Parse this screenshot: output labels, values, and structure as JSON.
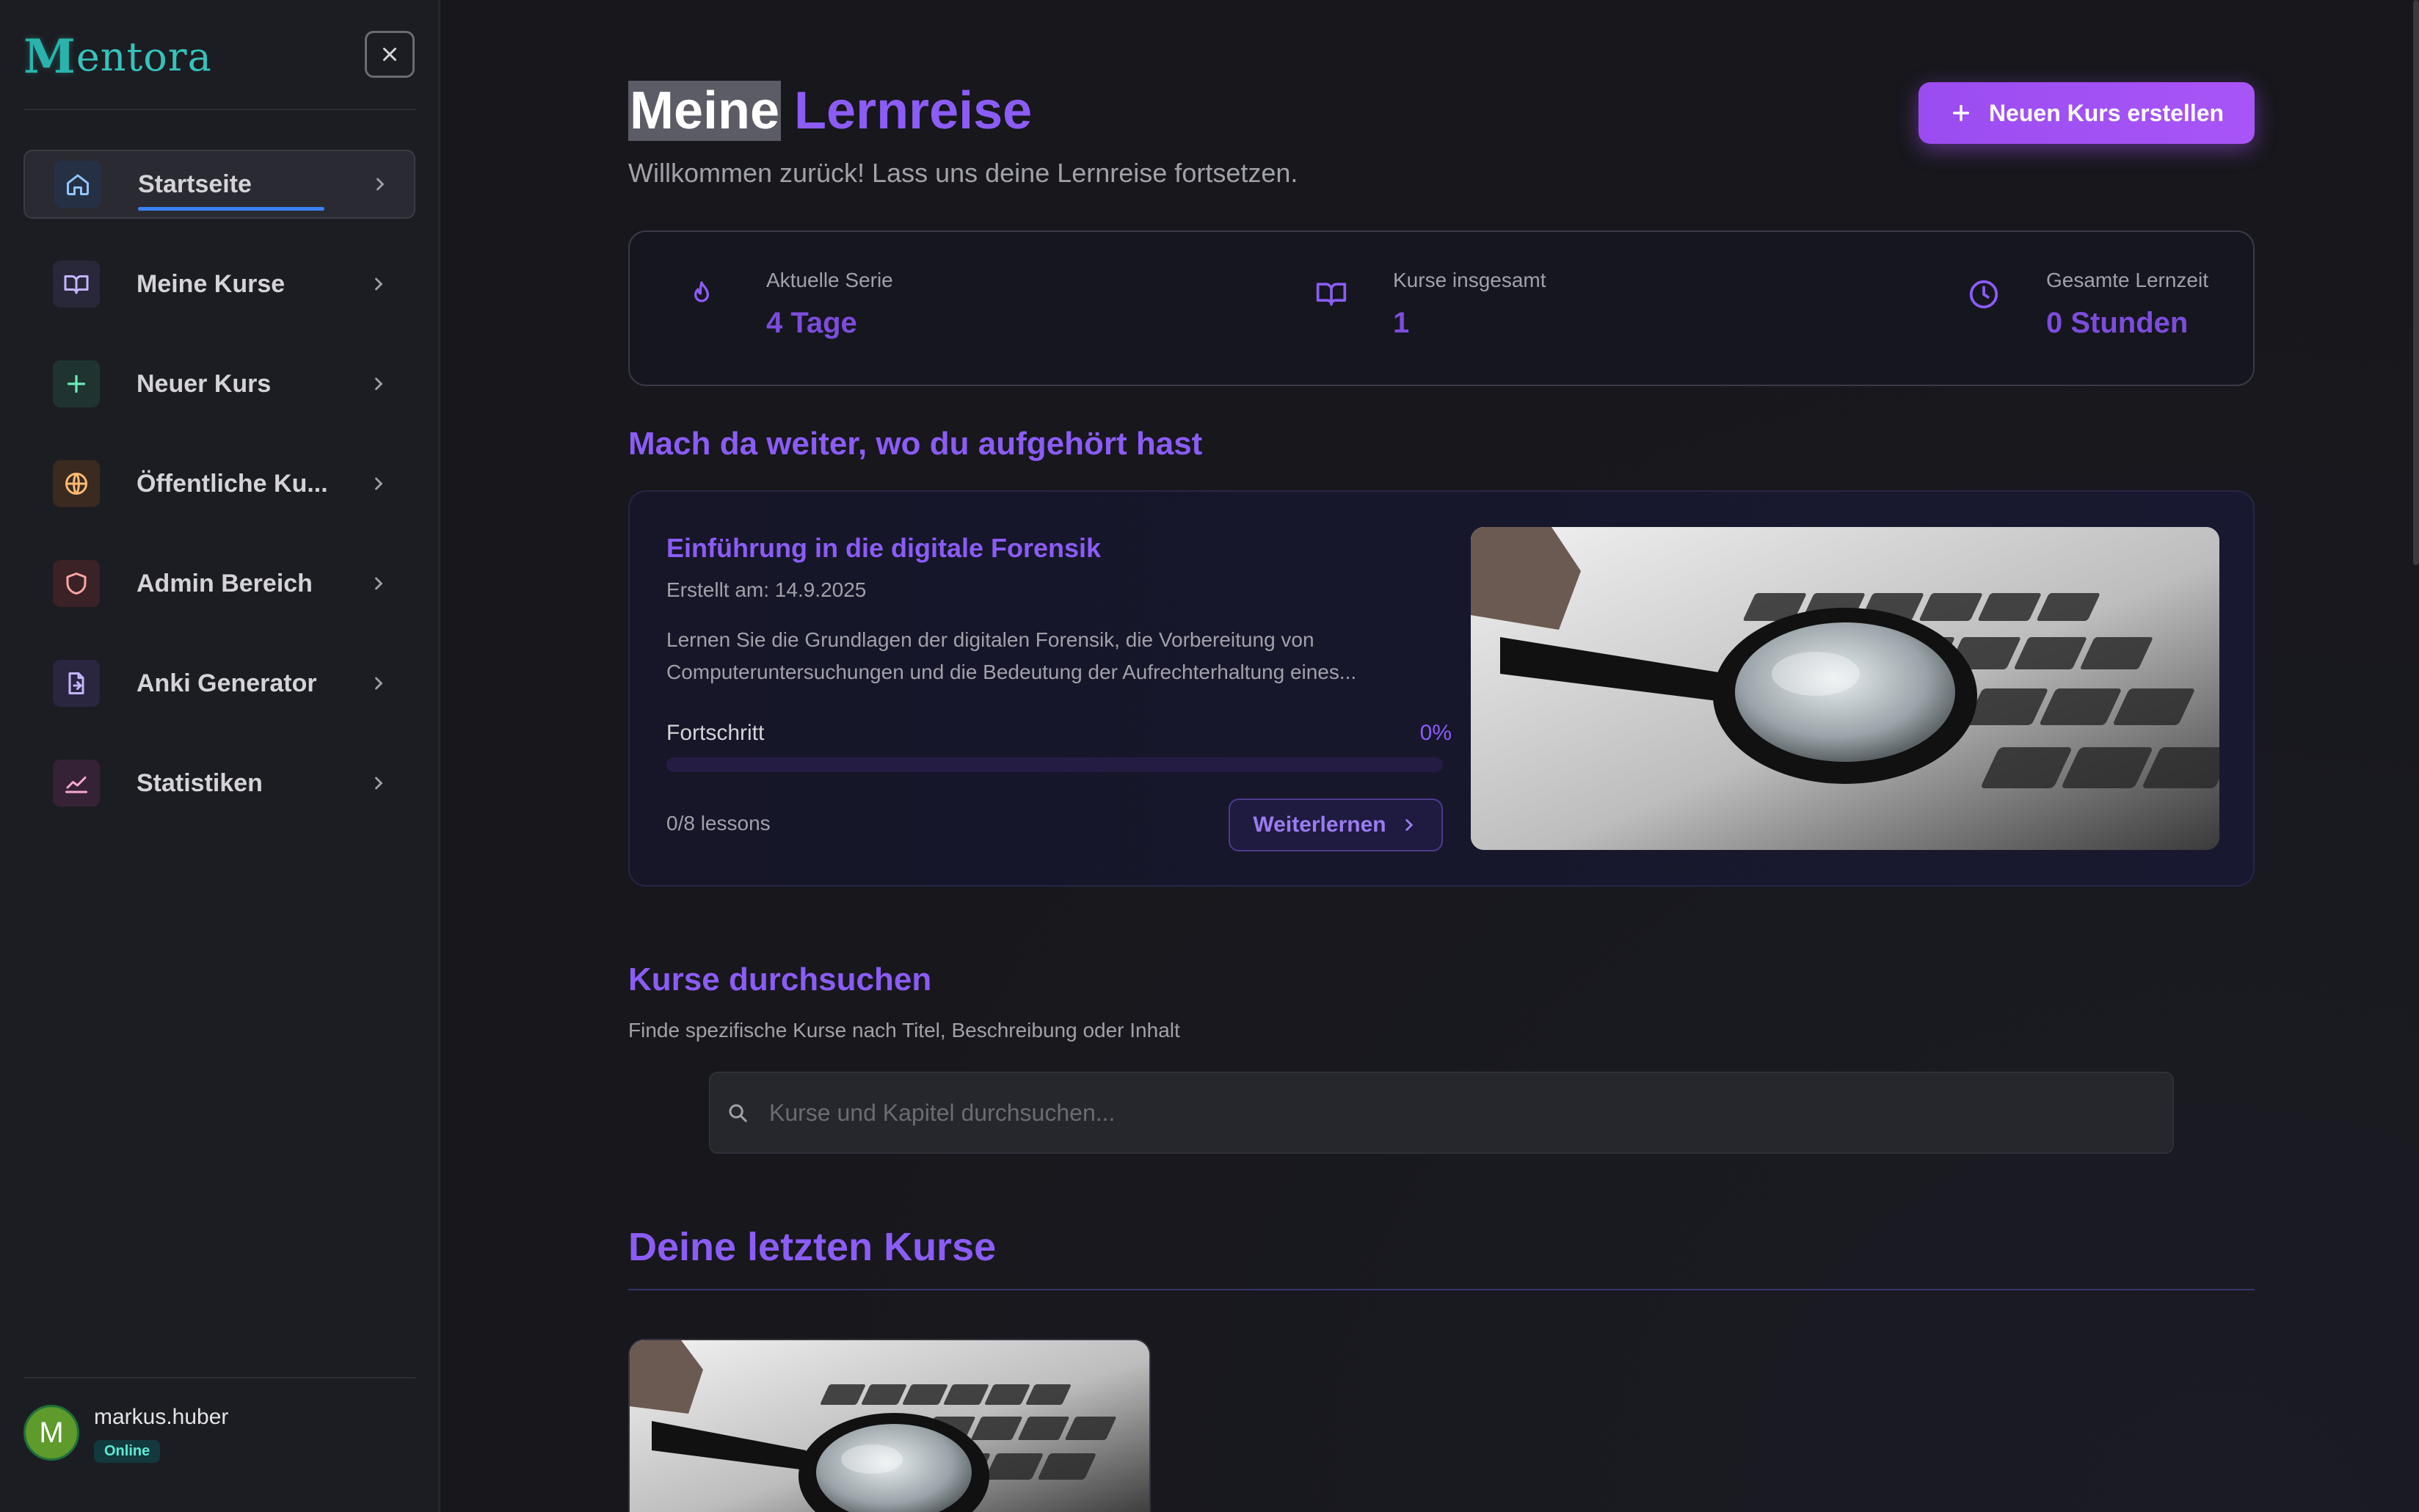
{
  "app": {
    "logo_initial": "M",
    "logo_rest": "entora"
  },
  "sidebar": {
    "items": [
      {
        "label": "Startseite",
        "icon": "home-icon"
      },
      {
        "label": "Meine Kurse",
        "icon": "book-icon"
      },
      {
        "label": "Neuer Kurs",
        "icon": "plus-icon"
      },
      {
        "label": "Öffentliche Ku...",
        "icon": "globe-icon"
      },
      {
        "label": "Admin Bereich",
        "icon": "shield-icon"
      },
      {
        "label": "Anki Generator",
        "icon": "file-export-icon"
      },
      {
        "label": "Statistiken",
        "icon": "chart-line-icon"
      }
    ],
    "user": {
      "avatar_initial": "M",
      "name": "markus.huber",
      "status": "Online"
    }
  },
  "header": {
    "title_word1": "Meine",
    "title_word2": "Lernreise",
    "subtitle": "Willkommen zurück! Lass uns deine Lernreise fortsetzen.",
    "create_button": "Neuen Kurs erstellen"
  },
  "stats": [
    {
      "label": "Aktuelle Serie",
      "value": "4 Tage",
      "icon": "flame-icon"
    },
    {
      "label": "Kurse insgesamt",
      "value": "1",
      "icon": "book-open-icon"
    },
    {
      "label": "Gesamte Lernzeit",
      "value": "0 Stunden",
      "icon": "clock-icon"
    }
  ],
  "continue": {
    "section_title": "Mach da weiter, wo du aufgehört hast",
    "course_title": "Einführung in die digitale Forensik",
    "created": "Erstellt am: 14.9.2025",
    "description": "Lernen Sie die Grundlagen der digitalen Forensik, die Vorbereitung von Computeruntersuchungen und die Bedeutung der Aufrechterhaltung eines...",
    "progress_label": "Fortschritt",
    "progress_text": "0%",
    "progress_value": 0,
    "lessons": "0/8 lessons",
    "button": "Weiterlernen"
  },
  "search": {
    "title": "Kurse durchsuchen",
    "subtitle": "Finde spezifische Kurse nach Titel, Beschreibung oder Inhalt",
    "placeholder": "Kurse und Kapitel durchsuchen..."
  },
  "recent": {
    "title": "Deine letzten Kurse"
  },
  "colors": {
    "accent": "#8b5cf6",
    "teal": "#34c3bc",
    "background": "#17171c"
  }
}
